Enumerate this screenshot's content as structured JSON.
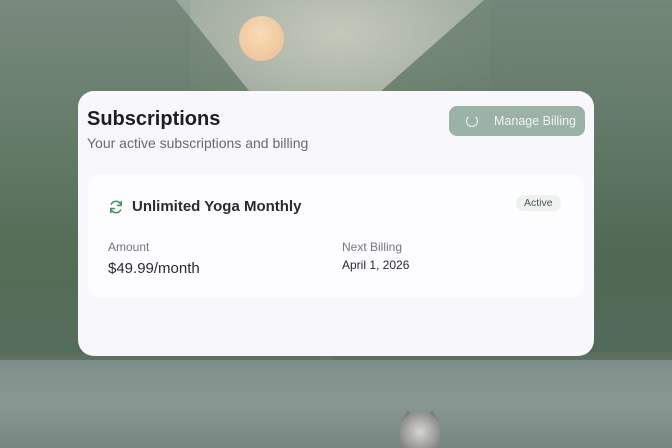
{
  "subscriptions_card": {
    "title": "Subscriptions",
    "subtitle": "Your active subscriptions and billing",
    "manage_billing_label": "Manage Billing"
  },
  "subscription": {
    "name": "Unlimited Yoga Monthly",
    "status": "Active",
    "amount_label": "Amount",
    "amount_value": "$49.99/month",
    "next_billing_label": "Next Billing",
    "next_billing_value": "April 1, 2026"
  },
  "icons": {
    "manage_billing": "loading-spinner-icon",
    "subscription": "refresh-icon"
  },
  "colors": {
    "accent": "#9bb3a7",
    "refresh_icon": "#3f9a6a",
    "badge_bg": "#eef1ee"
  }
}
